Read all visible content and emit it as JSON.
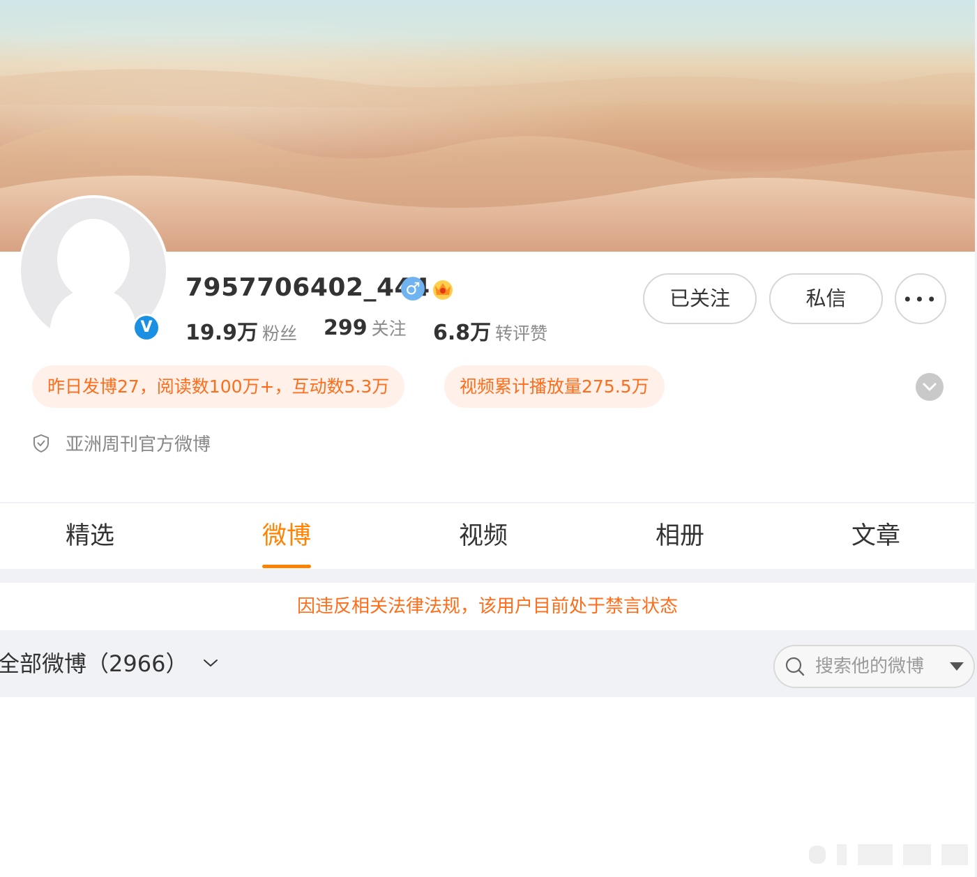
{
  "profile": {
    "username": "7957706402_444",
    "gender_symbol": "♂",
    "verified_symbol": "V",
    "stats": [
      {
        "value": "19.9万",
        "label": "粉丝"
      },
      {
        "value": "299",
        "label": "关注"
      },
      {
        "value": "6.8万",
        "label": "转评赞"
      }
    ],
    "actions": {
      "follow_label": "已关注",
      "message_label": "私信",
      "more_label": "•••"
    },
    "highlights": [
      "昨日发博27，阅读数100万+，互动数5.3万",
      "视频累计播放量275.5万"
    ],
    "description": "亚洲周刊官方微博"
  },
  "tabs": [
    {
      "label": "精选",
      "active": false
    },
    {
      "label": "微博",
      "active": true
    },
    {
      "label": "视频",
      "active": false
    },
    {
      "label": "相册",
      "active": false
    },
    {
      "label": "文章",
      "active": false
    }
  ],
  "notice": "因违反相关法律法规，该用户目前处于禁言状态",
  "filter": {
    "label": "全部微博（2966）"
  },
  "search": {
    "placeholder": "搜索他的微博"
  },
  "colors": {
    "accent": "#ff8200",
    "highlight_text": "#ff6d1a",
    "highlight_bg": "#fff1ea",
    "verify_blue": "#1b90e3",
    "gender_blue": "#6fb3f0"
  },
  "icons": [
    "gender-male-icon",
    "crown-icon",
    "verified-icon",
    "shield-icon",
    "chevron-down-icon",
    "search-icon",
    "caret-down-icon",
    "more-dots-icon"
  ]
}
